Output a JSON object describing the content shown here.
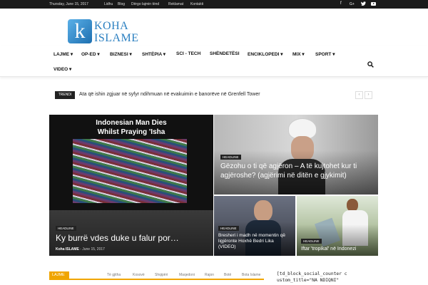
{
  "topbar": {
    "date": "Thursday, June 15, 2017",
    "links": [
      "Lidhu",
      "Blog",
      "Dërgo lajmin tënd",
      "Reklamat",
      "Kontakti"
    ],
    "social_icons": [
      "facebook-icon",
      "google-plus-icon",
      "twitter-icon",
      "youtube-icon"
    ]
  },
  "logo": {
    "letter": "k",
    "line1": "KOHA",
    "line2": "ISLAME"
  },
  "nav": {
    "items": [
      "LAJME",
      "OP-ED",
      "BIZNESI",
      "SHTËPIA",
      "SCI - TECH",
      "SHËNDETËSI",
      "ENCIKLOPEDI",
      "MIX",
      "SPORT",
      "VIDEO"
    ],
    "dropdown_flags": [
      true,
      true,
      true,
      true,
      false,
      false,
      true,
      true,
      true,
      true
    ]
  },
  "trending": {
    "label": "TRENDI",
    "text": "Ata që ishin zgjuar në syfyr ndihmuan në evakuimin e banorëve në Grenfell Tower",
    "prev": "‹",
    "next": "›"
  },
  "tiles": {
    "main": {
      "video_title_1": "Indonesian Man Dies",
      "video_title_2": "Whilst Praying 'Isha",
      "tag": "HEADLINE",
      "title": "Ky burrë vdes duke u falur por…",
      "author": "Koha ISLAME",
      "sep": "-",
      "date": "June 15, 2017"
    },
    "top_right": {
      "tag": "HEADLINE",
      "title": "Gëzohu o ti që agjëron – A të kujtohet kur ti agjëroshe? (agjërimi në ditën e gjykimit)"
    },
    "bottom_mid": {
      "tag": "HEADLINE",
      "title": "Bresheri i madh në momentin që ligjëronte Hoxhë Bedri Lika (VIDEO)"
    },
    "bottom_right": {
      "tag": "HEADLINE",
      "title": "Iftar 'tropikal' në Indonezi"
    }
  },
  "bottom_bar": {
    "label": "LAJME",
    "tabs": [
      "Të gjitha",
      "Kosovë",
      "Shqipëri",
      "Maqedoni",
      "Rajon",
      "Botë",
      "Bota Islame"
    ],
    "code": "[td_block_social_counter custom_title=\"NA NDIQNI\""
  },
  "colors": {
    "accent": "#f0a500",
    "brand": "#2a7fc0",
    "topbar": "#1a1a1a"
  }
}
